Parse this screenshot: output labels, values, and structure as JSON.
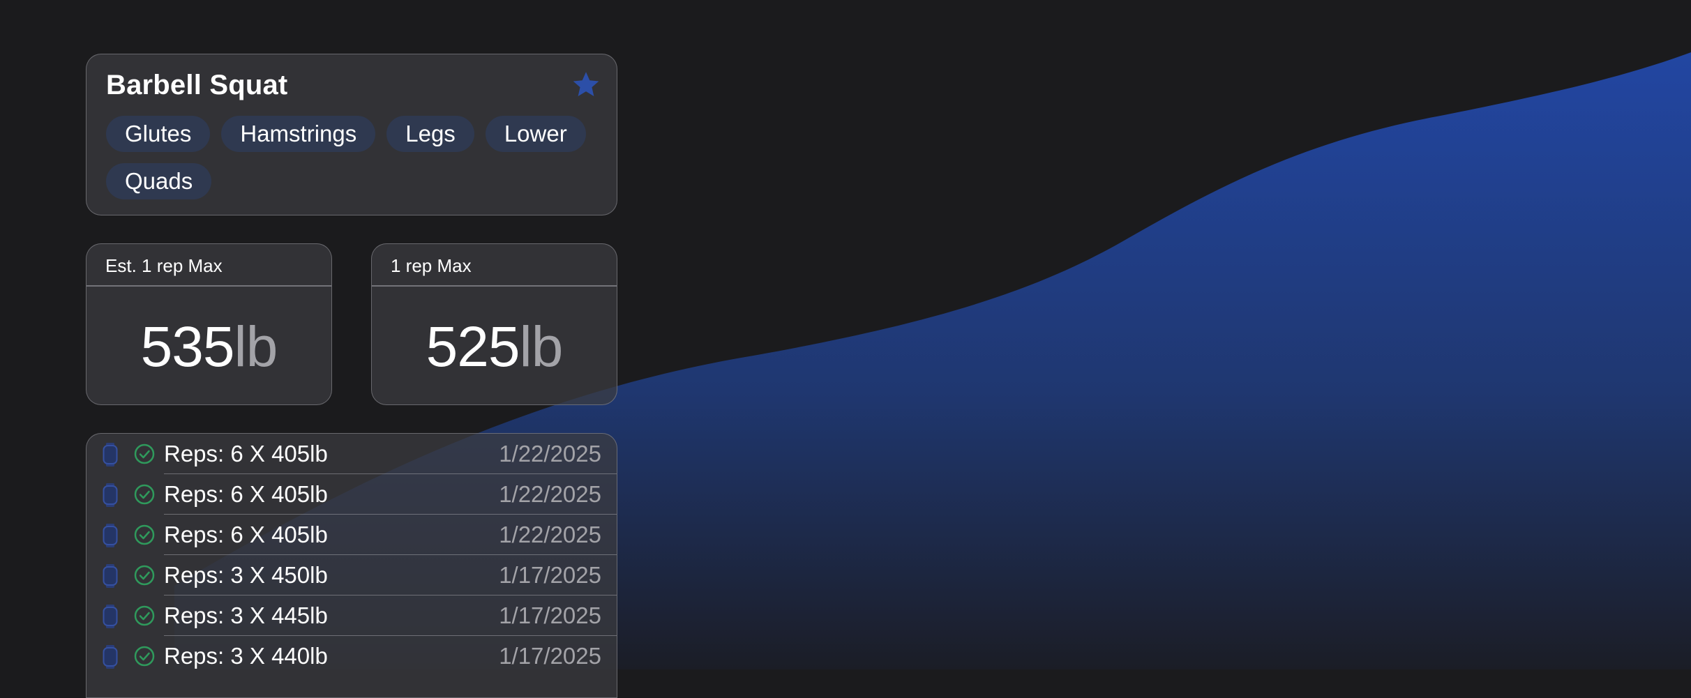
{
  "exercise": {
    "title": "Barbell Squat",
    "favorite_icon": "star-icon",
    "tags": [
      "Glutes",
      "Hamstrings",
      "Legs",
      "Lower",
      "Quads"
    ]
  },
  "stats": {
    "est_one_rep_max": {
      "label": "Est. 1 rep Max",
      "value": "535",
      "unit": "lb"
    },
    "one_rep_max": {
      "label": "1 rep Max",
      "value": "525",
      "unit": "lb"
    }
  },
  "sets": [
    {
      "text": "Reps: 6 X 405lb",
      "date": "1/22/2025"
    },
    {
      "text": "Reps: 6 X 405lb",
      "date": "1/22/2025"
    },
    {
      "text": "Reps: 6 X 405lb",
      "date": "1/22/2025"
    },
    {
      "text": "Reps: 3 X 450lb",
      "date": "1/17/2025"
    },
    {
      "text": "Reps: 3 X 445lb",
      "date": "1/17/2025"
    },
    {
      "text": "Reps: 3 X 440lb",
      "date": "1/17/2025"
    }
  ],
  "icons": {
    "set_source": "watch-icon",
    "set_status": "check-circle-icon"
  },
  "colors": {
    "background": "#1b1b1d",
    "accent_blue": "#2447a3",
    "tag_background": "#2f3950",
    "check_green": "#2f9a5c",
    "secondary_text": "#a3a3a8"
  }
}
